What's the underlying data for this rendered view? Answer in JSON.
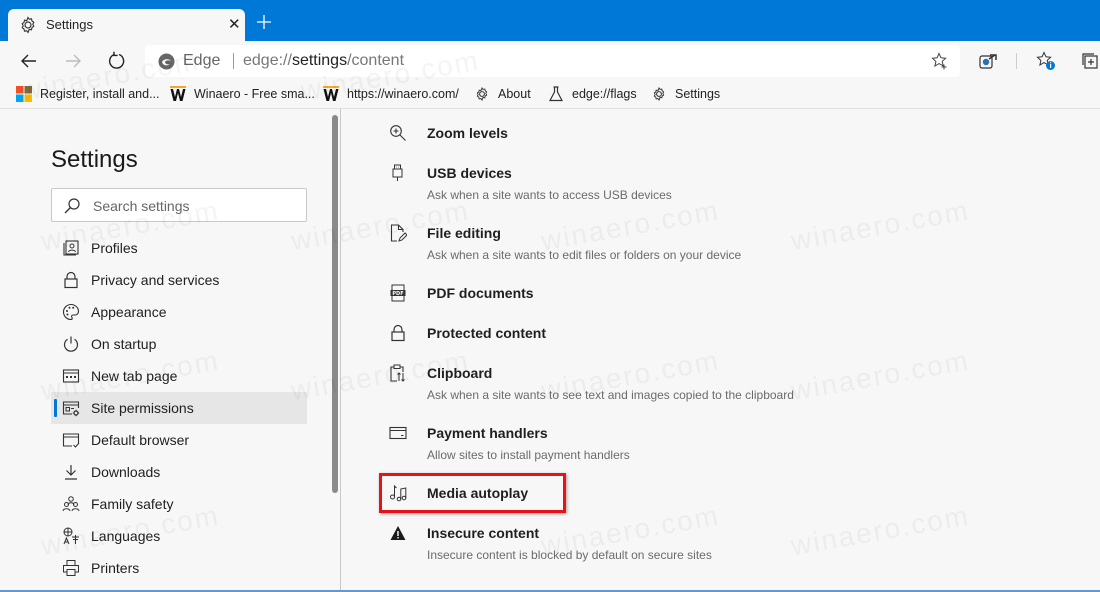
{
  "browser": {
    "tab": {
      "title": "Settings",
      "icon": "gear-icon",
      "close": "✕"
    },
    "new_tab_icon": "plus-icon",
    "address": {
      "brand": "Edge",
      "url_prefix": "edge://",
      "url_strong": "settings",
      "url_suffix": "/content"
    },
    "favorites": [
      {
        "label": "Register, install and...",
        "icon": "microsoft-logo-icon"
      },
      {
        "label": "Winaero - Free sma...",
        "icon": "winaero-w-icon"
      },
      {
        "label": "https://winaero.com/",
        "icon": "winaero-w-icon"
      },
      {
        "label": "About",
        "icon": "gear-icon"
      },
      {
        "label": "edge://flags",
        "icon": "flask-icon"
      },
      {
        "label": "Settings",
        "icon": "gear-icon"
      }
    ]
  },
  "colors": {
    "accent": "#0078d7",
    "highlight_box": "#e8111a",
    "background": "#f7f7f7"
  },
  "sidebar": {
    "title": "Settings",
    "search_placeholder": "Search settings",
    "items": [
      {
        "label": "Profiles",
        "icon": "profile-icon"
      },
      {
        "label": "Privacy and services",
        "icon": "lock-icon"
      },
      {
        "label": "Appearance",
        "icon": "palette-icon"
      },
      {
        "label": "On startup",
        "icon": "power-icon"
      },
      {
        "label": "New tab page",
        "icon": "new-tab-page-icon"
      },
      {
        "label": "Site permissions",
        "icon": "site-permissions-icon",
        "active": true
      },
      {
        "label": "Default browser",
        "icon": "default-browser-icon"
      },
      {
        "label": "Downloads",
        "icon": "download-icon"
      },
      {
        "label": "Family safety",
        "icon": "family-icon"
      },
      {
        "label": "Languages",
        "icon": "languages-icon"
      },
      {
        "label": "Printers",
        "icon": "printer-icon"
      }
    ]
  },
  "content": {
    "items": [
      {
        "title": "Zoom levels",
        "desc": "",
        "icon": "zoom-in-icon"
      },
      {
        "title": "USB devices",
        "desc": "Ask when a site wants to access USB devices",
        "icon": "usb-icon"
      },
      {
        "title": "File editing",
        "desc": "Ask when a site wants to edit files or folders on your device",
        "icon": "file-edit-icon"
      },
      {
        "title": "PDF documents",
        "desc": "",
        "icon": "pdf-icon"
      },
      {
        "title": "Protected content",
        "desc": "",
        "icon": "lock-icon"
      },
      {
        "title": "Clipboard",
        "desc": "Ask when a site wants to see text and images copied to the clipboard",
        "icon": "clipboard-icon"
      },
      {
        "title": "Payment handlers",
        "desc": "Allow sites to install payment handlers",
        "icon": "card-icon"
      },
      {
        "title": "Media autoplay",
        "desc": "",
        "icon": "music-note-icon",
        "highlighted": true
      },
      {
        "title": "Insecure content",
        "desc": "Insecure content is blocked by default on secure sites",
        "icon": "warning-icon"
      }
    ]
  },
  "watermark": "winaero.com"
}
